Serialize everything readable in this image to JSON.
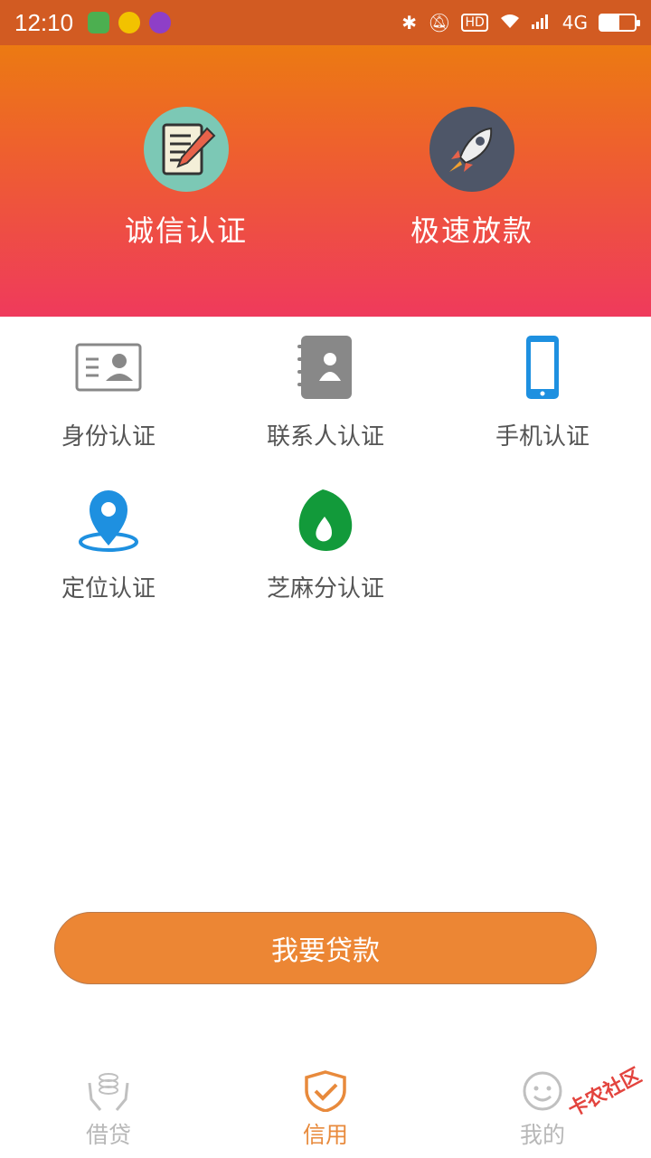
{
  "status_bar": {
    "time": "12:10",
    "network": "4G",
    "hd": "HD",
    "battery_level": 0.55,
    "notification_icons": [
      "wechat-icon",
      "plus-app-icon",
      "purple-app-icon"
    ]
  },
  "hero": {
    "items": [
      {
        "label": "诚信认证",
        "icon": "notepad-pen-icon",
        "circle_color": "#7cc8b5"
      },
      {
        "label": "极速放款",
        "icon": "rocket-icon",
        "circle_color": "#4e5668"
      }
    ]
  },
  "verify": {
    "items": [
      {
        "label": "身份认证",
        "icon": "id-card-icon"
      },
      {
        "label": "联系人认证",
        "icon": "contacts-book-icon"
      },
      {
        "label": "手机认证",
        "icon": "mobile-phone-icon"
      },
      {
        "label": "定位认证",
        "icon": "location-pin-icon"
      },
      {
        "label": "芝麻分认证",
        "icon": "sesame-credit-icon"
      }
    ]
  },
  "action": {
    "loan_button": "我要贷款"
  },
  "nav": {
    "items": [
      {
        "label": "借贷",
        "icon": "hands-coins-icon",
        "active": false
      },
      {
        "label": "信用",
        "icon": "shield-check-icon",
        "active": true
      },
      {
        "label": "我的",
        "icon": "smiley-face-icon",
        "active": false
      }
    ]
  },
  "watermark": "卡农社区",
  "colors": {
    "status_bar": "#d25b22",
    "hero_top": "#ec7a12",
    "hero_bottom": "#ef3a5c",
    "accent": "#ec8634",
    "nav_active": "#e88a3c",
    "nav_inactive": "#b8b8b8",
    "phone_blue": "#1e90e0",
    "sesame_green": "#129a3a"
  }
}
